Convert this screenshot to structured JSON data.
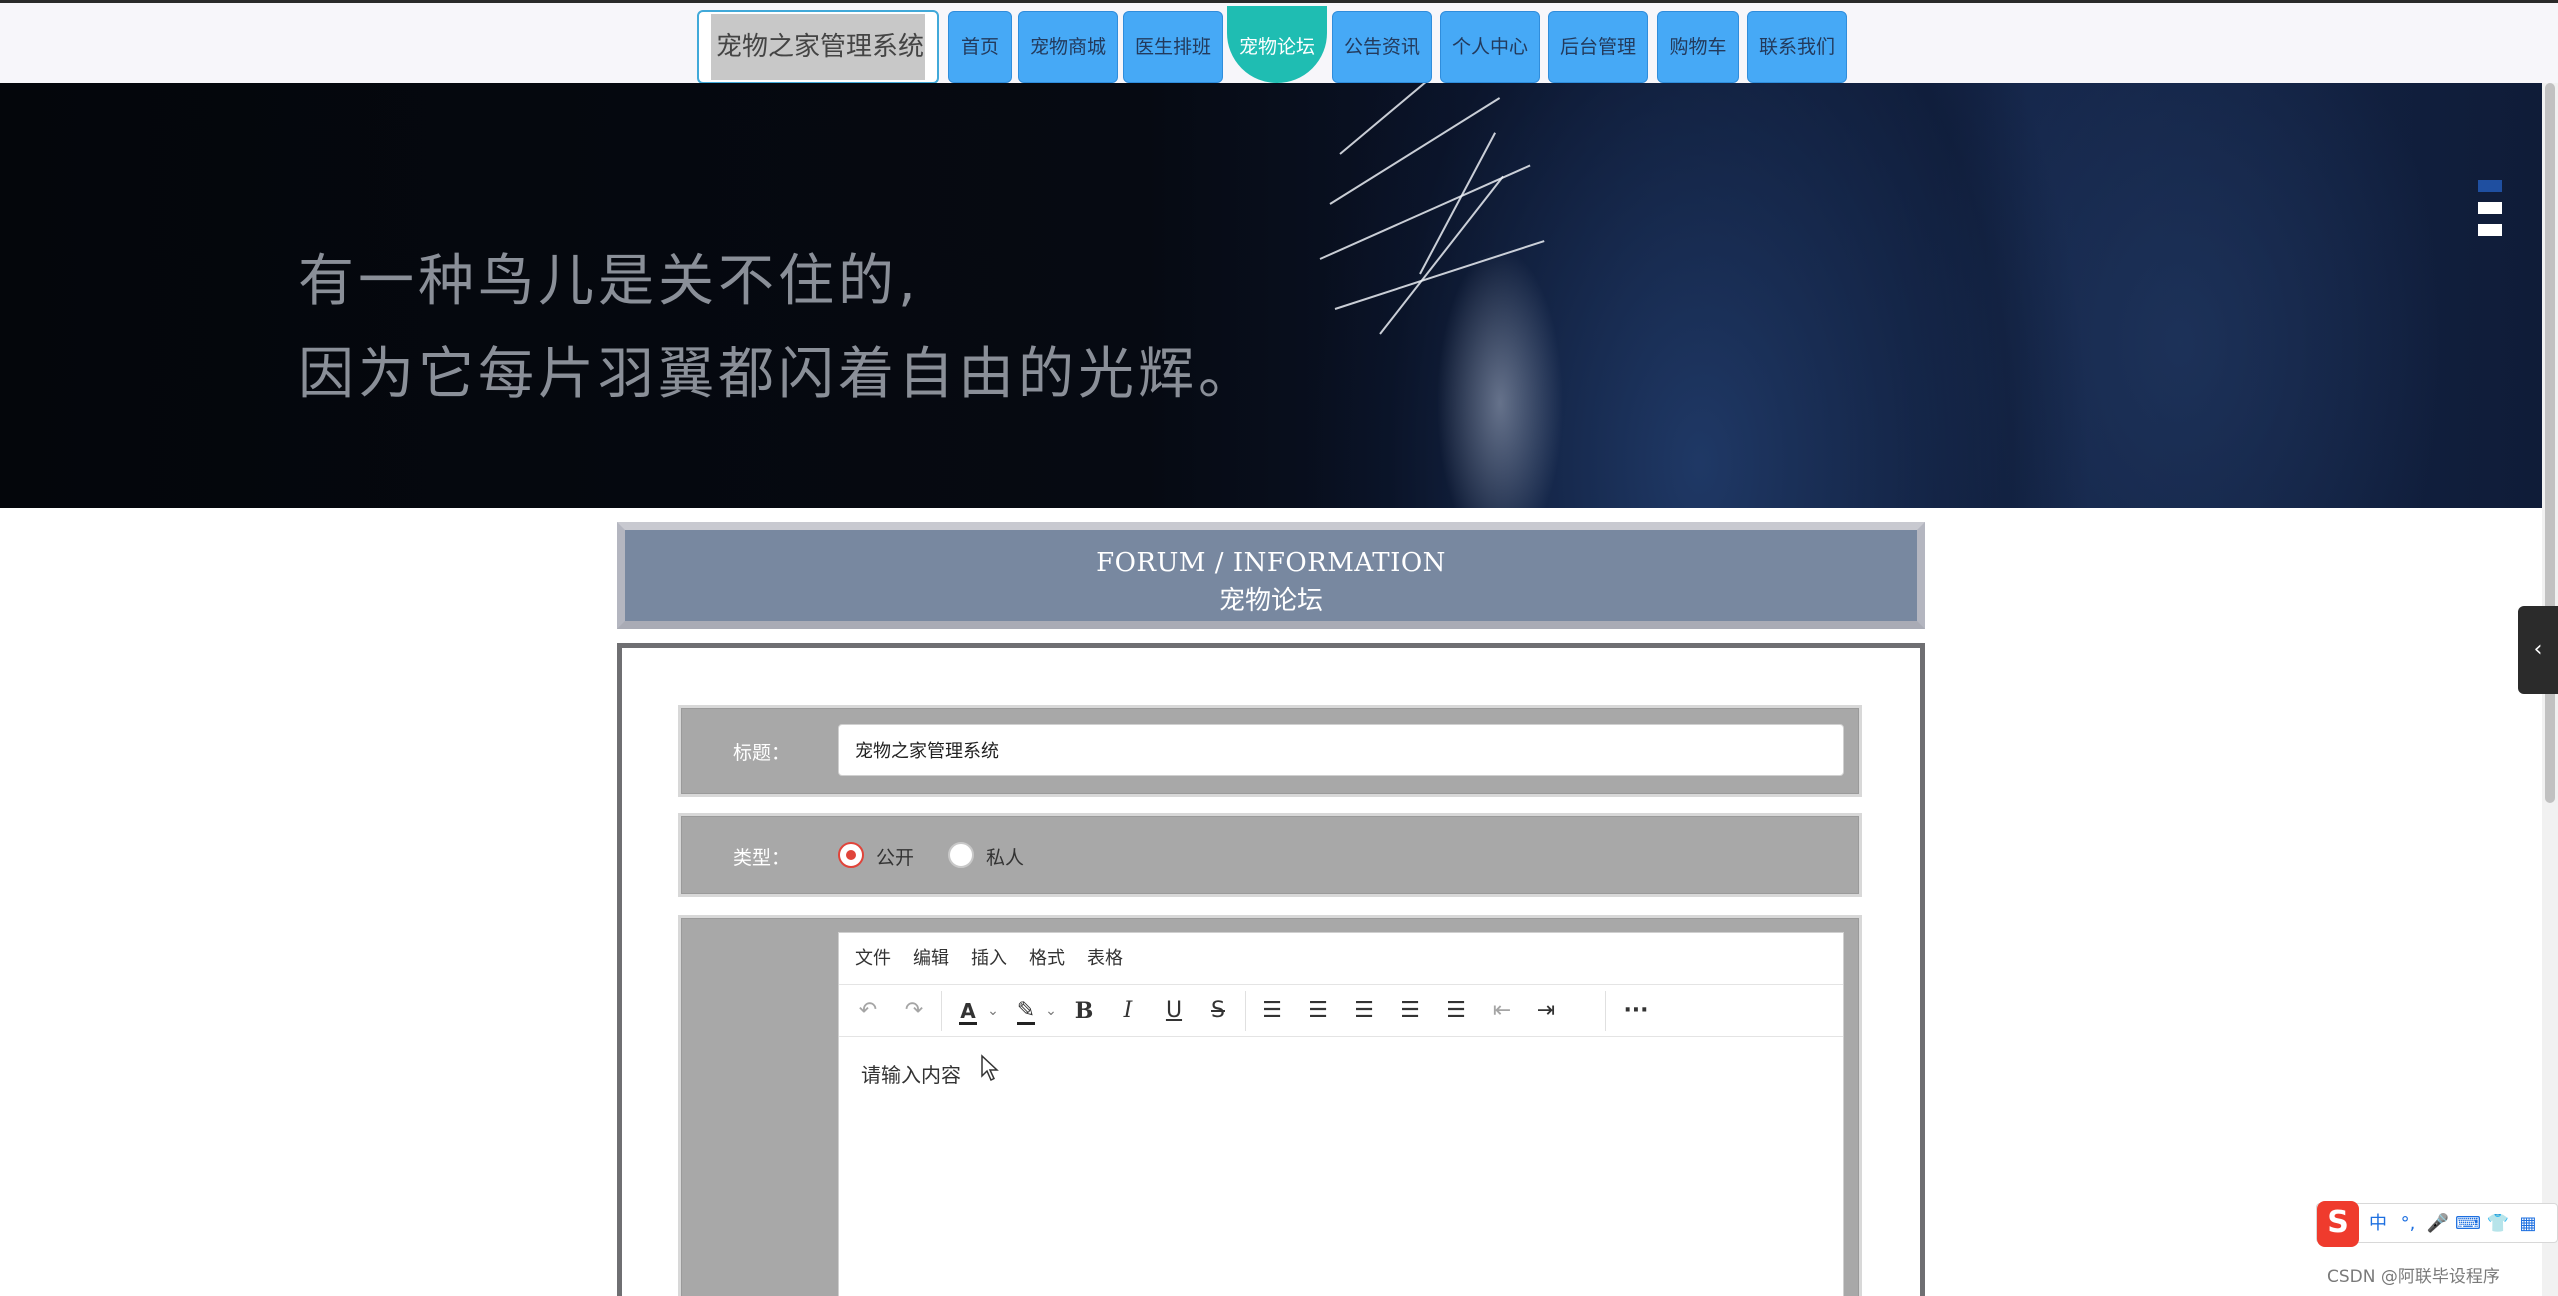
{
  "nav": {
    "brand": "宠物之家管理系统",
    "items": [
      {
        "label": "首页"
      },
      {
        "label": "宠物商城"
      },
      {
        "label": "医生排班"
      },
      {
        "label": "宠物论坛",
        "active": true
      },
      {
        "label": "公告资讯"
      },
      {
        "label": "个人中心"
      },
      {
        "label": "后台管理"
      },
      {
        "label": "购物车"
      },
      {
        "label": "联系我们"
      }
    ]
  },
  "hero": {
    "line1": "有一种鸟儿是关不住的,",
    "line2": "因为它每片羽翼都闪着自由的光辉。",
    "slide_count": 3,
    "active_slide": 1
  },
  "section": {
    "title_en": "FORUM / INFORMATION",
    "title_cn": "宠物论坛"
  },
  "form": {
    "title_label": "标题：",
    "title_value": "宠物之家管理系统",
    "type_label": "类型：",
    "type_options": [
      {
        "label": "公开",
        "checked": true
      },
      {
        "label": "私人",
        "checked": false
      }
    ]
  },
  "editor": {
    "menu": [
      "文件",
      "编辑",
      "插入",
      "格式",
      "表格"
    ],
    "toolbar_icons": [
      "undo-icon",
      "redo-icon",
      "font-color-icon",
      "highlight-icon",
      "bold-icon",
      "italic-icon",
      "underline-icon",
      "strikethrough-icon",
      "line-height-icon",
      "align-left-icon",
      "align-center-icon",
      "align-right-icon",
      "align-justify-icon",
      "outdent-icon",
      "indent-icon",
      "more-icon"
    ],
    "placeholder": "请输入内容"
  },
  "ime": {
    "logo": "S",
    "items": [
      "中",
      "°,",
      "🎤",
      "⌨",
      "👕",
      "▦"
    ]
  },
  "watermark": "CSDN @阿联毕设程序",
  "colors": {
    "nav_button": "#46a9f6",
    "nav_active": "#1fbdb2",
    "title_panel": "#7888a0",
    "form_row": "#a8a8a8",
    "radio_checked": "#e0443a",
    "slider_active_dot": "#1f4fa0"
  }
}
